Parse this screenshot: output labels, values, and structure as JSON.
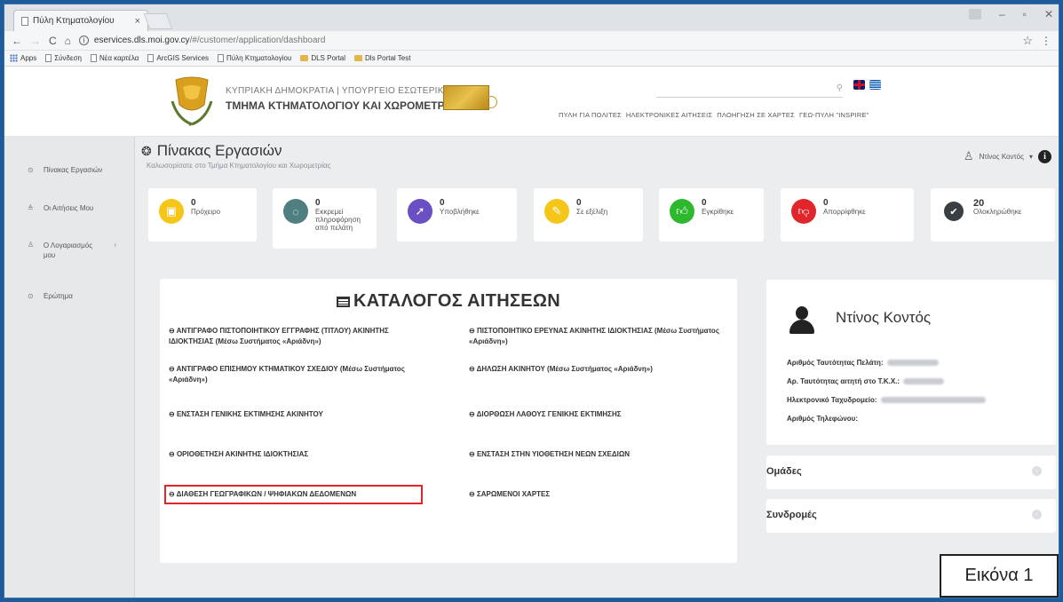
{
  "browser": {
    "tab_title": "Πύλη Κτηματολογίου",
    "tab_close": "×",
    "url_host": "eservices.dls.moi.gov.cy",
    "url_path": "/#/customer/application/dashboard",
    "star": "☆",
    "bookmarks": [
      "Apps",
      "Σύνδεση",
      "Νέα καρτέλα",
      "ArcGIS Services",
      "Πύλη Κτηματολογίου",
      "DLS Portal",
      "Dls Portal Test"
    ]
  },
  "header": {
    "gov_line1": "ΚΥΠΡΙΑΚΗ ΔΗΜΟΚΡΑΤΙΑ | ΥΠΟΥΡΓΕΙΟ ΕΣΩΤΕΡΙΚΩΝ",
    "gov_line2": "ΤΜΗΜΑ ΚΤΗΜΑΤΟΛΟΓΙΟΥ ΚΑΙ ΧΩΡΟΜΕΤΡΙΑΣ",
    "nav": [
      "ΠΥΛΗ ΓΙΑ ΠΟΛΙΤΕΣ",
      "ΗΛΕΚΤΡΟΝΙΚΕΣ ΑΙΤΗΣΕΙΣ",
      "ΠΛΟΗΓΗΣΗ ΣΕ ΧΑΡΤΕΣ",
      "ΓΕΩ-ΠΥΛΗ \"INSPIRE\""
    ]
  },
  "sidebar": {
    "items": [
      {
        "label": "Πίνακας Εργασιών",
        "icon": "dashboard-icon"
      },
      {
        "label": "Οι Αιτήσεις Μου",
        "icon": "applications-icon"
      },
      {
        "label": "Ο Λογαριασμός μου",
        "icon": "account-icon"
      },
      {
        "label": "Ερώτημα",
        "icon": "query-icon"
      }
    ]
  },
  "main": {
    "title": "Πίνακας Εργασιών",
    "subtitle": "Καλωσορίσατε στο Τμήμα Κτηματολογίου και Χωρομετρίας",
    "user_name": "Ντίνος Κοντός",
    "user_caret": "▾"
  },
  "status_cards": [
    {
      "count": "0",
      "label": "Πρόχειρο",
      "color": "#f5c518",
      "icon": "draft-icon"
    },
    {
      "count": "0",
      "label": "Εκκρεμεί πληροφόρηση από πελάτη",
      "color": "#4f7f80",
      "icon": "pending-info-icon"
    },
    {
      "count": "0",
      "label": "Υποβλήθηκε",
      "color": "#6a4fc2",
      "icon": "submitted-icon"
    },
    {
      "count": "0",
      "label": "Σε εξέλιξη",
      "color": "#f5c518",
      "icon": "in-progress-icon"
    },
    {
      "count": "0",
      "label": "Εγκρίθηκε",
      "color": "#2eb82e",
      "icon": "approved-icon"
    },
    {
      "count": "0",
      "label": "Απορρίφθηκε",
      "color": "#e0262b",
      "icon": "rejected-icon"
    },
    {
      "count": "20",
      "label": "Ολοκληρώθηκε",
      "color": "#3a3f44",
      "icon": "completed-icon"
    }
  ],
  "catalog": {
    "title": "ΚΑΤΑΛΟΓΟΣ ΑΙΤΗΣΕΩΝ",
    "bullet": "⊖",
    "left": [
      "ΑΝΤΙΓΡΑΦΟ ΠΙΣΤΟΠΟΙΗΤΙΚΟΥ ΕΓΓΡΑΦΗΣ (ΤΙΤΛΟΥ) ΑΚΙΝΗΤΗΣ ΙΔΙΟΚΤΗΣΙΑΣ (Μέσω Συστήματος «Αριάδνη»)",
      "ΑΝΤΙΓΡΑΦΟ ΕΠΙΣΗΜΟΥ ΚΤΗΜΑΤΙΚΟΥ ΣΧΕΔΙΟΥ (Μέσω Συστήματος «Αριάδνη»)",
      "ΕΝΣΤΑΣΗ ΓΕΝΙΚΗΣ ΕΚΤΙΜΗΣΗΣ ΑΚΙΝΗΤΟΥ",
      "ΟΡΙΟΘΕΤΗΣΗ ΑΚΙΝΗΤΗΣ ΙΔΙΟΚΤΗΣΙΑΣ",
      "ΔΙΑΘΕΣΗ ΓΕΩΓΡΑΦΙΚΩΝ / ΨΗΦΙΑΚΩΝ ΔΕΔΟΜΕΝΩΝ"
    ],
    "right": [
      "ΠΙΣΤΟΠΟΙΗΤΙΚΟ ΕΡΕΥΝΑΣ ΑΚΙΝΗΤΗΣ ΙΔΙΟΚΤΗΣΙΑΣ (Μέσω Συστήματος «Αριάδνη»)",
      "ΔΗΛΩΣΗ ΑΚΙΝΗΤΟΥ (Μέσω Συστήματος «Αριάδνη»)",
      "ΔΙΟΡΘΩΣΗ ΛΑΘΟΥΣ ΓΕΝΙΚΗΣ ΕΚΤΙΜΗΣΗΣ",
      "ΕΝΣΤΑΣΗ ΣΤΗΝ ΥΙΟΘΕΤΗΣΗ ΝΕΩΝ ΣΧΕΔΙΩΝ",
      "ΣΑΡΩΜΕΝΟΙ ΧΑΡΤΕΣ"
    ],
    "highlight_color": "#e0262b"
  },
  "profile": {
    "name": "Ντίνος Κοντός",
    "rows": [
      "Αριθμός Ταυτότητας Πελάτη:",
      "Αρ. Ταυτότητας αιτητή στο Τ.Κ.Χ.:",
      "Ηλεκτρονικό Ταχυδρομείο:",
      "Αριθμός Τηλεφώνου:"
    ]
  },
  "groups_label": "Ομάδες",
  "subscriptions_label": "Συνδρομές",
  "caption": "Εικόνα 1"
}
